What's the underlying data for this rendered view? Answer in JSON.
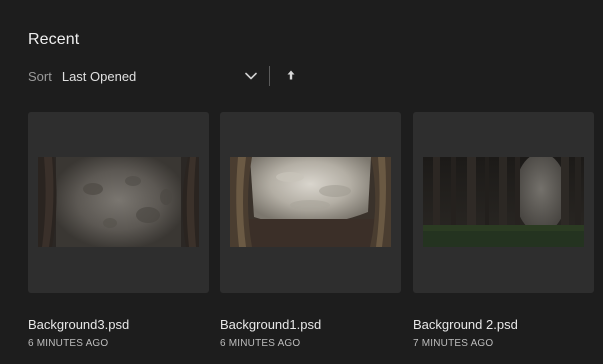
{
  "header": {
    "title": "Recent"
  },
  "sort": {
    "label": "Sort",
    "value": "Last Opened",
    "dropdown_icon": "chevron-down-icon",
    "direction_icon": "arrow-up-icon"
  },
  "files": [
    {
      "name": "Background3.psd",
      "opened": "6 MINUTES AGO"
    },
    {
      "name": "Background1.psd",
      "opened": "6 MINUTES AGO"
    },
    {
      "name": "Background 2.psd",
      "opened": "7 MINUTES AGO"
    }
  ],
  "colors": {
    "background": "#1d1d1d",
    "card": "#2e2e2e"
  }
}
